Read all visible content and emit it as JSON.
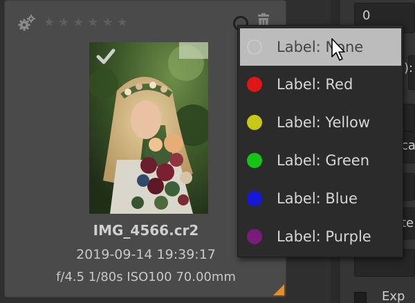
{
  "card": {
    "filename": "IMG_4566.cr2",
    "datetime": "2019-09-14 19:39:17",
    "exif": "f/4.5 1/80s ISO100 70.00mm",
    "rating_stars": [
      "★",
      "★",
      "★",
      "★",
      "★",
      "★"
    ],
    "icons": {
      "settings": "gears-icon",
      "label": "color-label-icon",
      "delete": "trash-icon",
      "selected": "checkmark-icon"
    }
  },
  "label_menu": {
    "items": [
      {
        "label": "Label: None",
        "color": "none",
        "hover": true
      },
      {
        "label": "Label: Red",
        "color": "#e01515"
      },
      {
        "label": "Label: Yellow",
        "color": "#c8c817"
      },
      {
        "label": "Label: Green",
        "color": "#16c416"
      },
      {
        "label": "Label: Blue",
        "color": "#1717d8"
      },
      {
        "label": "Label: Purple",
        "color": "#7a1a7a"
      }
    ]
  },
  "right_panel": {
    "value": "0",
    "fragments": [
      "):",
      "ca",
      "te",
      "Exp"
    ]
  },
  "colors": {
    "accent_corner": "#e0902c",
    "menu_hover": "#bcbcbc"
  }
}
